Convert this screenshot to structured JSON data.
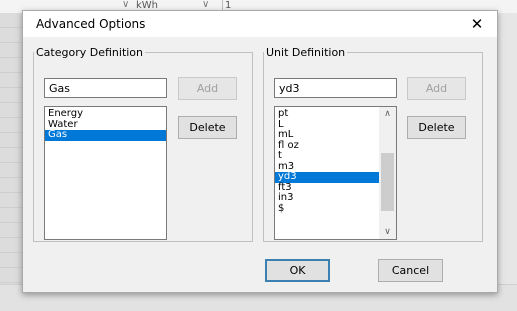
{
  "background": {
    "unit_cell": "kWh",
    "other_cell": "1"
  },
  "dialog": {
    "title": "Advanced Options",
    "close_symbol": "✕",
    "category": {
      "legend": "Category Definition",
      "input_value": "Gas",
      "add_label": "Add",
      "delete_label": "Delete",
      "items": [
        "Energy",
        "Water",
        "Gas"
      ],
      "selected": "Gas"
    },
    "unit": {
      "legend": "Unit Definition",
      "input_value": "yd3",
      "add_label": "Add",
      "delete_label": "Delete",
      "items": [
        "pt",
        "L",
        "mL",
        "fl oz",
        "t",
        "m3",
        "yd3",
        "ft3",
        "in3",
        "$"
      ],
      "selected": "yd3"
    },
    "ok_label": "OK",
    "cancel_label": "Cancel"
  }
}
